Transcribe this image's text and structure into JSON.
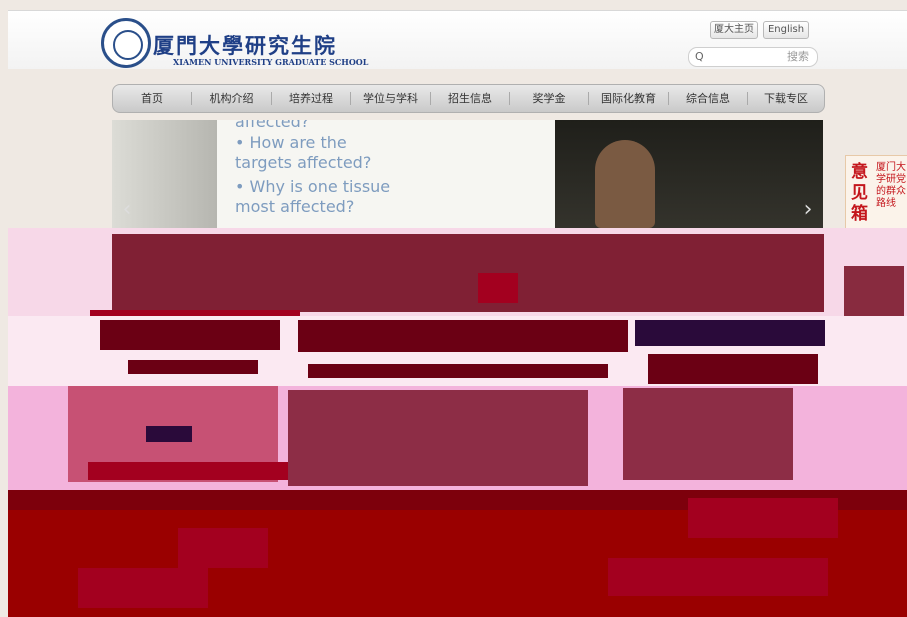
{
  "header": {
    "logo": {
      "cn": "厦門大學研究生院",
      "en": "XIAMEN UNIVERSITY GRADUATE SCHOOL"
    },
    "links": {
      "home": "厦大主页",
      "english": "English"
    },
    "search": {
      "icon": "search-icon",
      "placeholder": "搜索"
    }
  },
  "nav": {
    "items": [
      "首页",
      "机构介绍",
      "培养过程",
      "学位与学科",
      "招生信息",
      "奖学金",
      "国际化教育",
      "综合信息",
      "下载专区"
    ]
  },
  "slider": {
    "text_lines": [
      "affected?",
      "• How are the",
      "  targets affected?",
      "• Why is one tissue",
      "  most affected?"
    ],
    "prev_icon": "chevron-left-icon",
    "next_icon": "chevron-right-icon"
  },
  "opinion_box": {
    "big": "意见箱",
    "small": "厦门大学研党的群众路线"
  }
}
